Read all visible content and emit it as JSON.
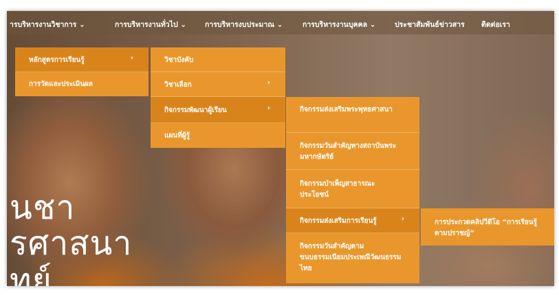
{
  "topnav": {
    "items": [
      {
        "label": "ารบริหารงานวิชาการ ⌄"
      },
      {
        "label": "การบริหารงานทั่วไป ⌄"
      },
      {
        "label": "การบริหารงบประมาณ ⌄"
      },
      {
        "label": "การบริหารงานบุคคล ⌄"
      },
      {
        "label": "ประชาสัมพันธ์ข่าวสาร"
      },
      {
        "label": "ติดต่อเรา"
      }
    ]
  },
  "hero": {
    "line1": "นชา",
    "line2": "รศาสนา",
    "line3": "ทย์"
  },
  "menu1": {
    "items": [
      {
        "label": "หลักสูตรการเรียนรู้",
        "arrow": "›"
      },
      {
        "label": "การวัดและประเมินผล"
      }
    ]
  },
  "menu2": {
    "items": [
      {
        "label": "วิชาบังคับ"
      },
      {
        "label": "วิชาเลือก",
        "arrow": "›"
      },
      {
        "label": "กิจกรรมพัฒนาผู้เรียน",
        "arrow": "›"
      },
      {
        "label": "แผนที่ผู้รู้"
      }
    ]
  },
  "menu3": {
    "items": [
      {
        "label": "กิจกรรมส่งเสริมพระพุทธศาสนา"
      },
      {
        "label": "กิจกรรมวันสำคัญทางสถาบันพระมหากษัตริย์"
      },
      {
        "label": "กิจกรรมบำเพ็ญสาธารณะประโยชน์"
      },
      {
        "label": "กิจกรรมส่งเสริมการเรียนรู้",
        "arrow": "›"
      },
      {
        "label": "กิจกรรมวันสำคัญตามขนบธรรมเนียมประเพณีวัฒนธรรมไทย"
      }
    ]
  },
  "menu4": {
    "items": [
      {
        "label": "การประกวดคลิปวีดีโอ “การเรียนรู้ตามปราชญ์”"
      }
    ]
  },
  "colors": {
    "menu_bg": "#e9972c",
    "menu_active": "#d9841b",
    "text": "#ffffff"
  }
}
